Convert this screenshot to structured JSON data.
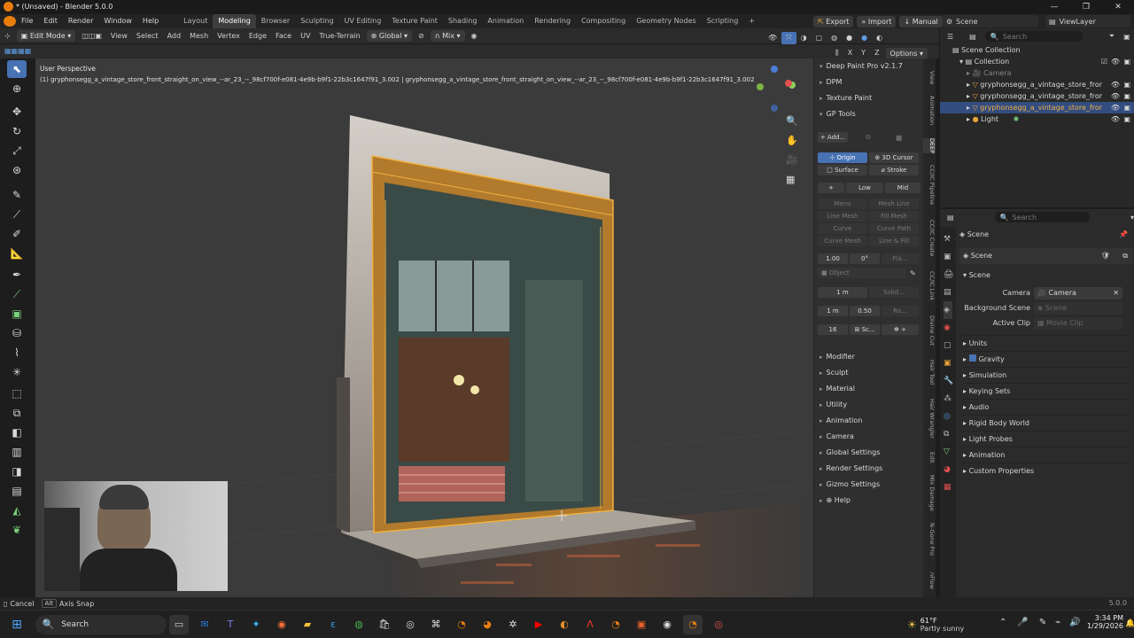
{
  "window": {
    "title": "* (Unsaved) - Blender 5.0.0",
    "controls": [
      "—",
      "❐",
      "✕"
    ]
  },
  "menu": {
    "items": [
      "File",
      "Edit",
      "Render",
      "Window",
      "Help"
    ],
    "workspaces": [
      "Layout",
      "Modeling",
      "Browser",
      "Sculpting",
      "UV Editing",
      "Texture Paint",
      "Shading",
      "Animation",
      "Rendering",
      "Compositing",
      "Geometry Nodes",
      "Scripting"
    ],
    "active_workspace": "Modeling",
    "export_label": "Export",
    "import_label": "Import",
    "manual_label": "Manual",
    "scene_label": "Scene",
    "viewlayer_label": "ViewLayer"
  },
  "header": {
    "mode": "Edit Mode",
    "menus": [
      "View",
      "Select",
      "Add",
      "Mesh",
      "Vertex",
      "Edge",
      "Face",
      "UV"
    ],
    "terrain_label": "True-Terrain",
    "orientation": "Global",
    "pivot": "Mix",
    "options_label": "Options",
    "axes": [
      "X",
      "Y",
      "Z"
    ]
  },
  "viewport": {
    "perspective_label": "User Perspective",
    "object_info": "(1) gryphonsegg_a_vintage_store_front_straight_on_view_--ar_23_--_98cf700f-e081-4e9b-b9f1-22b3c1647f91_3.002 | gryphonsegg_a_vintage_store_front_straight_on_view_--ar_23_--_98cf700f-e081-4e9b-b9f1-22b3c1647f91_3.002"
  },
  "npanel": {
    "plugin_title": "Deep Paint Pro v2.1.7",
    "dpm_label": "DPM",
    "texture_paint_label": "Texture Paint",
    "gp_tools_label": "GP Tools",
    "add_label": "Add...",
    "origin_label": "Origin",
    "cursor_label": "3D Cursor",
    "surface_label": "Surface",
    "stroke_label": "Stroke",
    "plus_label": "+",
    "low_label": "Low",
    "mid_label": "Mid",
    "menu_label": "Menu",
    "mesh_line_label": "Mesh Line",
    "line_mesh_label": "Line Mesh",
    "fill_mesh_label": "Fill Mesh",
    "curve_label": "Curve",
    "curve_path_label": "Curve Path",
    "curve_mesh_label": "Curve Mesh",
    "line_fill_label": "Line & Fill",
    "val_1": "1.00",
    "val_deg": "0°",
    "val_fla": "Fla...",
    "object_label": "Object",
    "val_1m_a": "1 m",
    "solid_label": "Solid...",
    "val_1m_b": "1 m",
    "val_050": "0.50",
    "ro_label": "Ro...",
    "val_16": "16",
    "sc_label": "Sc...",
    "sections": [
      "Modifier",
      "Sculpt",
      "Material",
      "Utility",
      "Animation",
      "Camera",
      "Global Settings",
      "Render Settings",
      "Gizmo Settings",
      "Help"
    ]
  },
  "vtabs": [
    "View",
    "Animation",
    "DEEP",
    "CC/IC Pipeline",
    "CC/IC Create",
    "CC/IC Link",
    "Divine Cut",
    "Hair Tool",
    "Hair Wrangler",
    "Edit",
    "Mix Damage",
    "N-Gone Pro",
    "nFlow"
  ],
  "outliner": {
    "search_placeholder": "Search",
    "root": "Scene Collection",
    "collection": "Collection",
    "items": [
      {
        "name": "Camera",
        "dim": true
      },
      {
        "name": "gryphonsegg_a_vintage_store_fror",
        "dim": false
      },
      {
        "name": "gryphonsegg_a_vintage_store_fror",
        "dim": false
      },
      {
        "name": "gryphonsegg_a_vintage_store_fror",
        "dim": false,
        "selected": true
      },
      {
        "name": "Light",
        "dim": false
      }
    ]
  },
  "properties": {
    "search_placeholder": "Search",
    "context_label": "Scene",
    "scene_block": "Scene",
    "panel_title": "Scene",
    "camera_label": "Camera",
    "camera_value": "Camera",
    "bg_scene_label": "Background Scene",
    "bg_scene_value": "Scene",
    "active_clip_label": "Active Clip",
    "active_clip_value": "Movie Clip",
    "sections": [
      "Units",
      "Gravity",
      "Simulation",
      "Keying Sets",
      "Audio",
      "Rigid Body World",
      "Light Probes",
      "Animation",
      "Custom Properties"
    ]
  },
  "status": {
    "cancel": "Cancel",
    "alt": "Alt",
    "axis_snap": "Axis Snap",
    "version": "5.0.0"
  },
  "taskbar": {
    "search_label": "Search",
    "weather_temp": "61°F",
    "weather_desc": "Partly sunny",
    "time": "3:34 PM",
    "date": "1/29/2026"
  },
  "colors": {
    "accent": "#4772b3",
    "selection_orange": "#e8a43a"
  }
}
